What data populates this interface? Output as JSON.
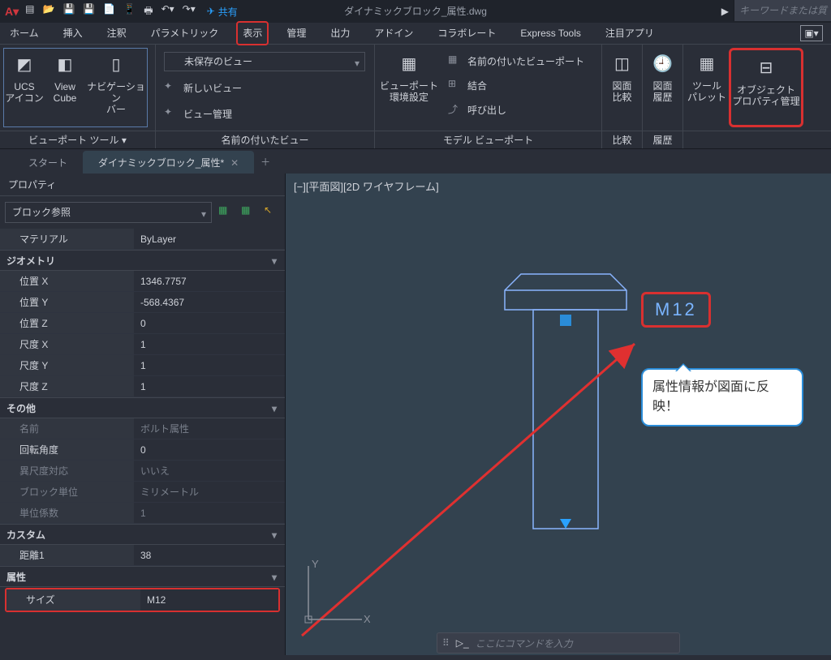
{
  "titlebar": {
    "share": "共有",
    "doc_title": "ダイナミックブロック_属性.dwg",
    "search_placeholder": "キーワードまたは質"
  },
  "menu": {
    "home": "ホーム",
    "insert": "挿入",
    "annotate": "注釈",
    "parametric": "パラメトリック",
    "view": "表示",
    "manage": "管理",
    "output": "出力",
    "addins": "アドイン",
    "collaborate": "コラボレート",
    "express": "Express Tools",
    "featured": "注目アプリ"
  },
  "ribbon": {
    "ucs_icon": "UCS\nアイコン",
    "view_cube": "View\nCube",
    "navbar": "ナビゲーション\nバー",
    "viewport_tools": "ビューポート ツール",
    "unsaved_view": "未保存のビュー",
    "new_view": "新しいビュー",
    "view_manage": "ビュー管理",
    "named_views": "名前の付いたビュー",
    "viewport_env": "ビューポート\n環境設定",
    "named_vp": "名前の付いたビューポート",
    "merge": "結合",
    "callout": "呼び出し",
    "model_vp": "モデル ビューポート",
    "dwg_compare": "図面\n比較",
    "dwg_history": "図面\n履歴",
    "compare": "比較",
    "history": "履歴",
    "tool_palette": "ツール\nパレット",
    "obj_prop_mgr": "オブジェクト\nプロパティ管理"
  },
  "tabs": {
    "start": "スタート",
    "active": "ダイナミックブロック_属性*"
  },
  "panel": {
    "title": "プロパティ",
    "selector": "ブロック参照",
    "material_k": "マテリアル",
    "material_v": "ByLayer",
    "geometry": "ジオメトリ",
    "posx_k": "位置 X",
    "posx_v": "1346.7757",
    "posy_k": "位置 Y",
    "posy_v": "-568.4367",
    "posz_k": "位置 Z",
    "posz_v": "0",
    "scx_k": "尺度 X",
    "scx_v": "1",
    "scy_k": "尺度 Y",
    "scy_v": "1",
    "scz_k": "尺度 Z",
    "scz_v": "1",
    "other": "その他",
    "name_k": "名前",
    "name_v": "ボルト属性",
    "rot_k": "回転角度",
    "rot_v": "0",
    "anno_k": "異尺度対応",
    "anno_v": "いいえ",
    "unit_k": "ブロック単位",
    "unit_v": "ミリメートル",
    "factor_k": "単位係数",
    "factor_v": "1",
    "custom": "カスタム",
    "dist_k": "距離1",
    "dist_v": "38",
    "attrs": "属性",
    "size_k": "サイズ",
    "size_v": "M12"
  },
  "canvas": {
    "view_label": "[−][平面図][2D ワイヤフレーム]",
    "m12_label": "M12",
    "callout_text": "属性情報が図面に反映！",
    "cmd_placeholder": "ここにコマンドを入力",
    "axis_y": "Y",
    "axis_x": "X"
  }
}
